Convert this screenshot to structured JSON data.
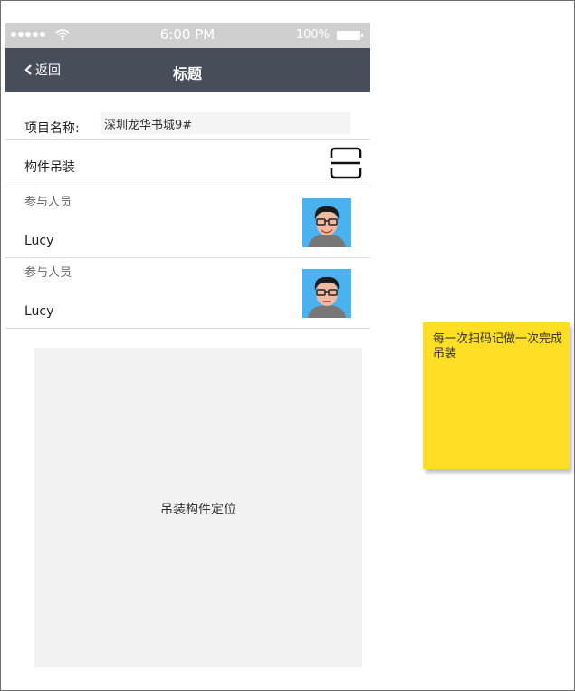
{
  "status_bar": {
    "time": "6:00 PM",
    "battery": "100%",
    "icons": [
      "signal-dots-icon",
      "wifi-icon",
      "battery-icon"
    ]
  },
  "nav": {
    "back_label": "返回",
    "title": "标题",
    "back_icon": "chevron-left-icon",
    "color": "#484d5a"
  },
  "project": {
    "label": "项目名称:",
    "value": "深圳龙华书城9#"
  },
  "hoist": {
    "label": "构件吊装",
    "scan_icon": "scan-icon"
  },
  "participants": [
    {
      "label": "参与人员",
      "name": "Lucy",
      "avatar_icon": "avatar-smile"
    },
    {
      "label": "参与人员",
      "name": "Lucy",
      "avatar_icon": "avatar-neutral"
    }
  ],
  "map_panel": {
    "label": "吊装构件定位"
  },
  "sticky_note": {
    "text": "每一次扫码记做一次完成吊装",
    "color": "#ffdf25"
  }
}
